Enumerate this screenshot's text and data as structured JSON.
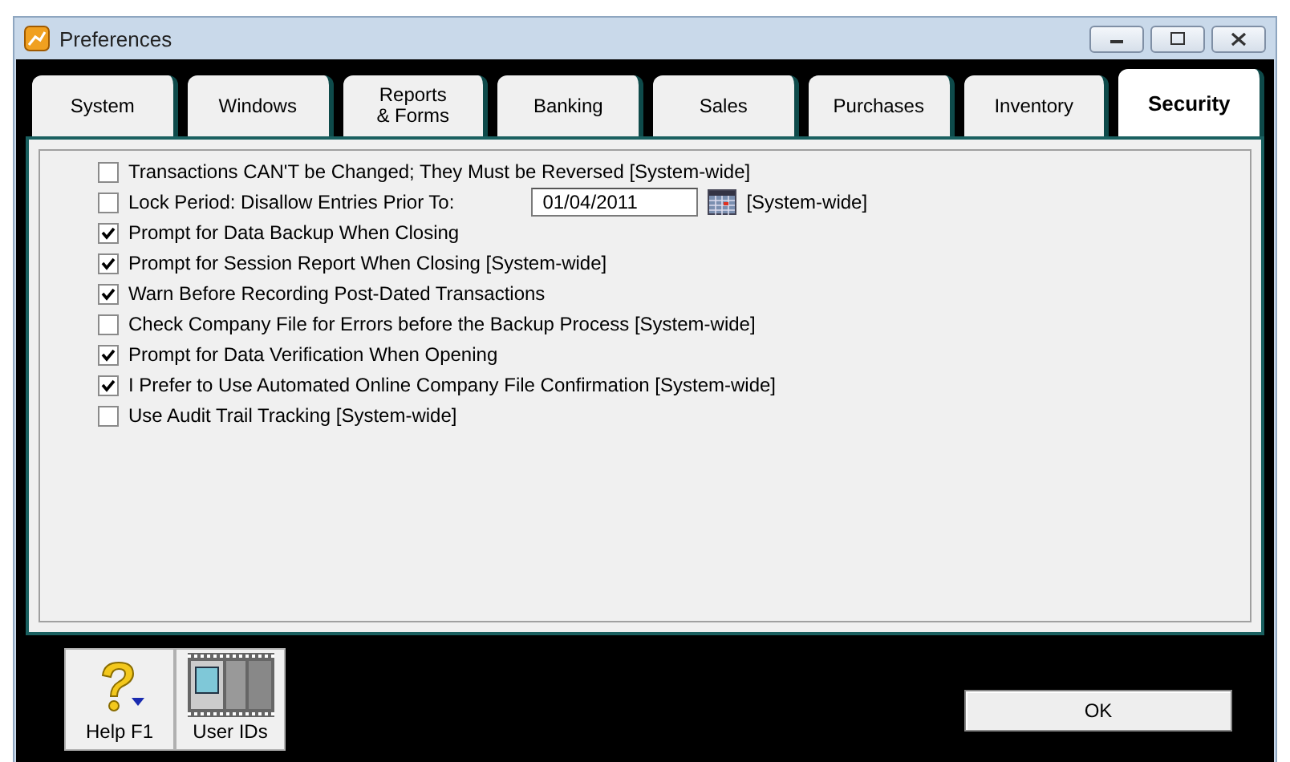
{
  "window": {
    "title": "Preferences"
  },
  "tabs": [
    {
      "label": "System",
      "selected": false
    },
    {
      "label": "Windows",
      "selected": false
    },
    {
      "label": "Reports\n& Forms",
      "selected": false
    },
    {
      "label": "Banking",
      "selected": false
    },
    {
      "label": "Sales",
      "selected": false
    },
    {
      "label": "Purchases",
      "selected": false
    },
    {
      "label": "Inventory",
      "selected": false
    },
    {
      "label": "Security",
      "selected": true
    }
  ],
  "options": [
    {
      "kind": "checkbox",
      "label": "Transactions CAN'T be Changed; They Must be Reversed [System-wide]",
      "checked": false
    },
    {
      "kind": "date",
      "label": "Lock Period: Disallow Entries Prior To:",
      "checked": false,
      "value": "01/04/2011",
      "suffix": "[System-wide]"
    },
    {
      "kind": "checkbox",
      "label": "Prompt for Data Backup When Closing",
      "checked": true
    },
    {
      "kind": "checkbox",
      "label": "Prompt for Session Report When Closing [System-wide]",
      "checked": true
    },
    {
      "kind": "checkbox",
      "label": "Warn Before Recording Post-Dated Transactions",
      "checked": true
    },
    {
      "kind": "checkbox",
      "label": "Check Company File for Errors before the Backup Process [System-wide]",
      "checked": false
    },
    {
      "kind": "checkbox",
      "label": "Prompt for Data Verification When Opening",
      "checked": true
    },
    {
      "kind": "checkbox",
      "label": "I Prefer to Use Automated Online Company File Confirmation [System-wide]",
      "checked": true
    },
    {
      "kind": "checkbox",
      "label": "Use Audit Trail Tracking [System-wide]",
      "checked": false
    }
  ],
  "tools": [
    {
      "kind": "help",
      "label": "Help F1"
    },
    {
      "kind": "users",
      "label": "User IDs"
    }
  ],
  "buttons": [
    "OK"
  ]
}
